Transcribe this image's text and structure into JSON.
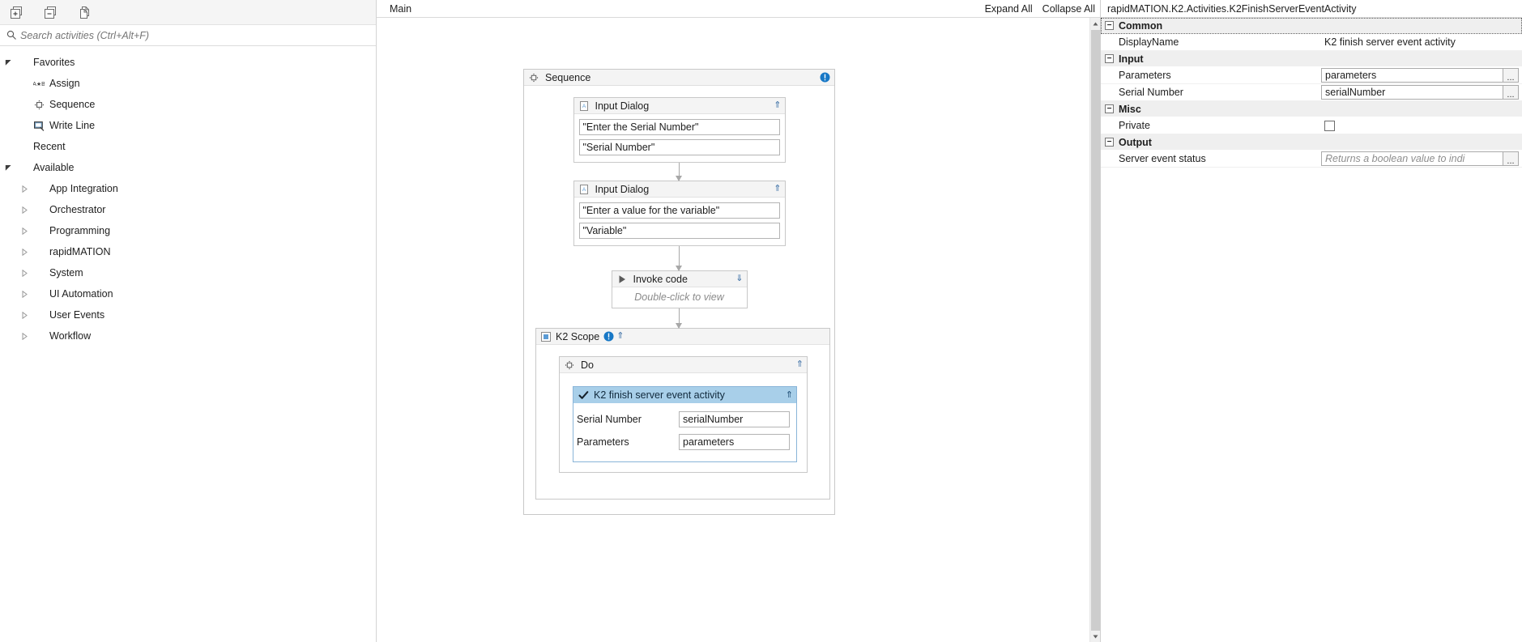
{
  "left_panel": {
    "toolbar": [
      {
        "name": "expand-all-icon",
        "tooltip": "Expand All"
      },
      {
        "name": "collapse-all-icon",
        "tooltip": "Collapse All"
      },
      {
        "name": "copy-icon",
        "tooltip": "Copy"
      }
    ],
    "search": {
      "placeholder": "Search activities (Ctrl+Alt+F)",
      "value": ""
    },
    "tree": [
      {
        "label": "Favorites",
        "level": 0,
        "arrow": "expanded",
        "icon": "none"
      },
      {
        "label": "Assign",
        "level": 2,
        "arrow": "none",
        "icon": "assign-icon"
      },
      {
        "label": "Sequence",
        "level": 2,
        "arrow": "none",
        "icon": "sequence-icon"
      },
      {
        "label": "Write Line",
        "level": 2,
        "arrow": "none",
        "icon": "writeline-icon"
      },
      {
        "label": "Recent",
        "level": 0,
        "arrow": "none",
        "icon": "none"
      },
      {
        "label": "Available",
        "level": 0,
        "arrow": "expanded",
        "icon": "none"
      },
      {
        "label": "App Integration",
        "level": 1,
        "arrow": "collapsed",
        "icon": "none"
      },
      {
        "label": "Orchestrator",
        "level": 1,
        "arrow": "collapsed",
        "icon": "none"
      },
      {
        "label": "Programming",
        "level": 1,
        "arrow": "collapsed",
        "icon": "none"
      },
      {
        "label": "rapidMATION",
        "level": 1,
        "arrow": "collapsed",
        "icon": "none"
      },
      {
        "label": "System",
        "level": 1,
        "arrow": "collapsed",
        "icon": "none"
      },
      {
        "label": "UI Automation",
        "level": 1,
        "arrow": "collapsed",
        "icon": "none"
      },
      {
        "label": "User Events",
        "level": 1,
        "arrow": "collapsed",
        "icon": "none"
      },
      {
        "label": "Workflow",
        "level": 1,
        "arrow": "collapsed",
        "icon": "none"
      }
    ]
  },
  "designer": {
    "breadcrumb": "Main",
    "expand_all": "Expand All",
    "collapse_all": "Collapse All",
    "sequence": {
      "title": "Sequence",
      "icon": "sequence-icon",
      "badge": "info-icon"
    },
    "input_dialog_1": {
      "title": "Input Dialog",
      "icon": "input-dialog-icon",
      "collapse_icon": "chevron-up-icon",
      "field_title": "\"Enter the Serial Number\"",
      "field_label": "\"Serial Number\""
    },
    "input_dialog_2": {
      "title": "Input Dialog",
      "icon": "input-dialog-icon",
      "collapse_icon": "chevron-up-icon",
      "field_title": "\"Enter a value for the variable\"",
      "field_label": "\"Variable\""
    },
    "invoke_code": {
      "title": "Invoke code",
      "icon": "play-icon",
      "expand_icon": "chevron-down-icon",
      "body_text": "Double-click to view"
    },
    "k2_scope": {
      "title": "K2 Scope",
      "icon": "scope-icon",
      "badge": "info-icon",
      "collapse_icon": "chevron-up-icon"
    },
    "do_block": {
      "title": "Do",
      "icon": "sequence-icon",
      "collapse_icon": "chevron-up-icon"
    },
    "k2_activity": {
      "title": "K2 finish server event activity",
      "icon": "check-icon",
      "collapse_icon": "chevron-up-icon",
      "rows": [
        {
          "label": "Serial Number",
          "value": "serialNumber"
        },
        {
          "label": "Parameters",
          "value": "parameters"
        }
      ]
    }
  },
  "properties": {
    "title": "rapidMATION.K2.Activities.K2FinishServerEventActivity",
    "groups": [
      {
        "name": "Common",
        "expander": "minus-icon",
        "rows": [
          {
            "name": "DisplayName",
            "kind": "text",
            "value": "K2 finish server event activity"
          }
        ]
      },
      {
        "name": "Input",
        "expander": "minus-icon",
        "rows": [
          {
            "name": "Parameters",
            "kind": "input",
            "value": "parameters",
            "placeholder": "",
            "has_ellipsis": true
          },
          {
            "name": "Serial Number",
            "kind": "input",
            "value": "serialNumber",
            "placeholder": "",
            "has_ellipsis": true
          }
        ]
      },
      {
        "name": "Misc",
        "expander": "minus-icon",
        "rows": [
          {
            "name": "Private",
            "kind": "checkbox",
            "checked": false
          }
        ]
      },
      {
        "name": "Output",
        "expander": "minus-icon",
        "rows": [
          {
            "name": "Server event status",
            "kind": "input",
            "value": "",
            "placeholder": "Returns a boolean value to indi",
            "has_ellipsis": true
          }
        ]
      }
    ],
    "ellipsis_label": "..."
  },
  "colors": {
    "accent": "#0a6ebd",
    "selection": "#a8cfe9",
    "panel_bg": "#f4f4f4",
    "border": "#c8c8c8"
  }
}
